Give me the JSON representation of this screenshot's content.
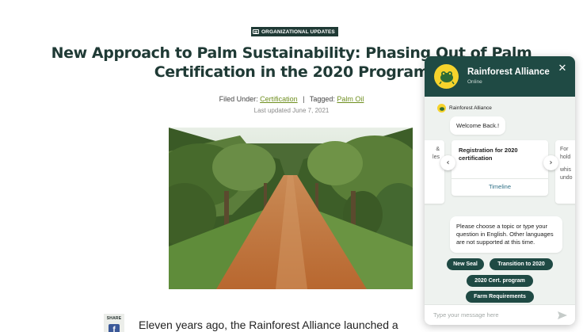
{
  "article": {
    "category": "ORGANIZATIONAL UPDATES",
    "title_line1": "New Approach to Palm Sustainability: Phasing Out of Palm",
    "title_line2": "Certification in the 2020 Program",
    "filed_under_label": "Filed Under:",
    "filed_under_link": "Certification",
    "separator": "|",
    "tagged_label": "Tagged:",
    "tagged_link": "Palm Oil",
    "last_updated": "Last updated June 7, 2021",
    "lead_text": "Eleven years ago, the Rainforest Alliance launched a"
  },
  "share": {
    "label": "SHARE",
    "facebook_glyph": "f"
  },
  "chat": {
    "name": "Rainforest Alliance",
    "status": "Online",
    "close_glyph": "✕",
    "sender_name": "Rainforest Alliance",
    "welcome": "Welcome Back.!",
    "carousel": {
      "left_fragment_1": "&",
      "left_fragment_2": "les",
      "main_title": "Registration for 2020 certification",
      "main_link": "Timeline",
      "right_fragment_1": "For",
      "right_fragment_2": "hold",
      "right_fragment_3": "whis",
      "right_fragment_4": "undo",
      "prev_glyph": "‹",
      "next_glyph": "›"
    },
    "prompt": "Please choose a topic or type your question in English. Other languages are not supported at this time.",
    "chips": [
      "New Seal",
      "Transition to 2020",
      "2020 Cert. program",
      "Farm Requirements"
    ],
    "input_placeholder": "Type your message here"
  },
  "colors": {
    "brand_dark": "#1f4a44",
    "title_green": "#1f3a35",
    "link_green": "#6f8f1f",
    "logo_yellow": "#f6d32c"
  }
}
